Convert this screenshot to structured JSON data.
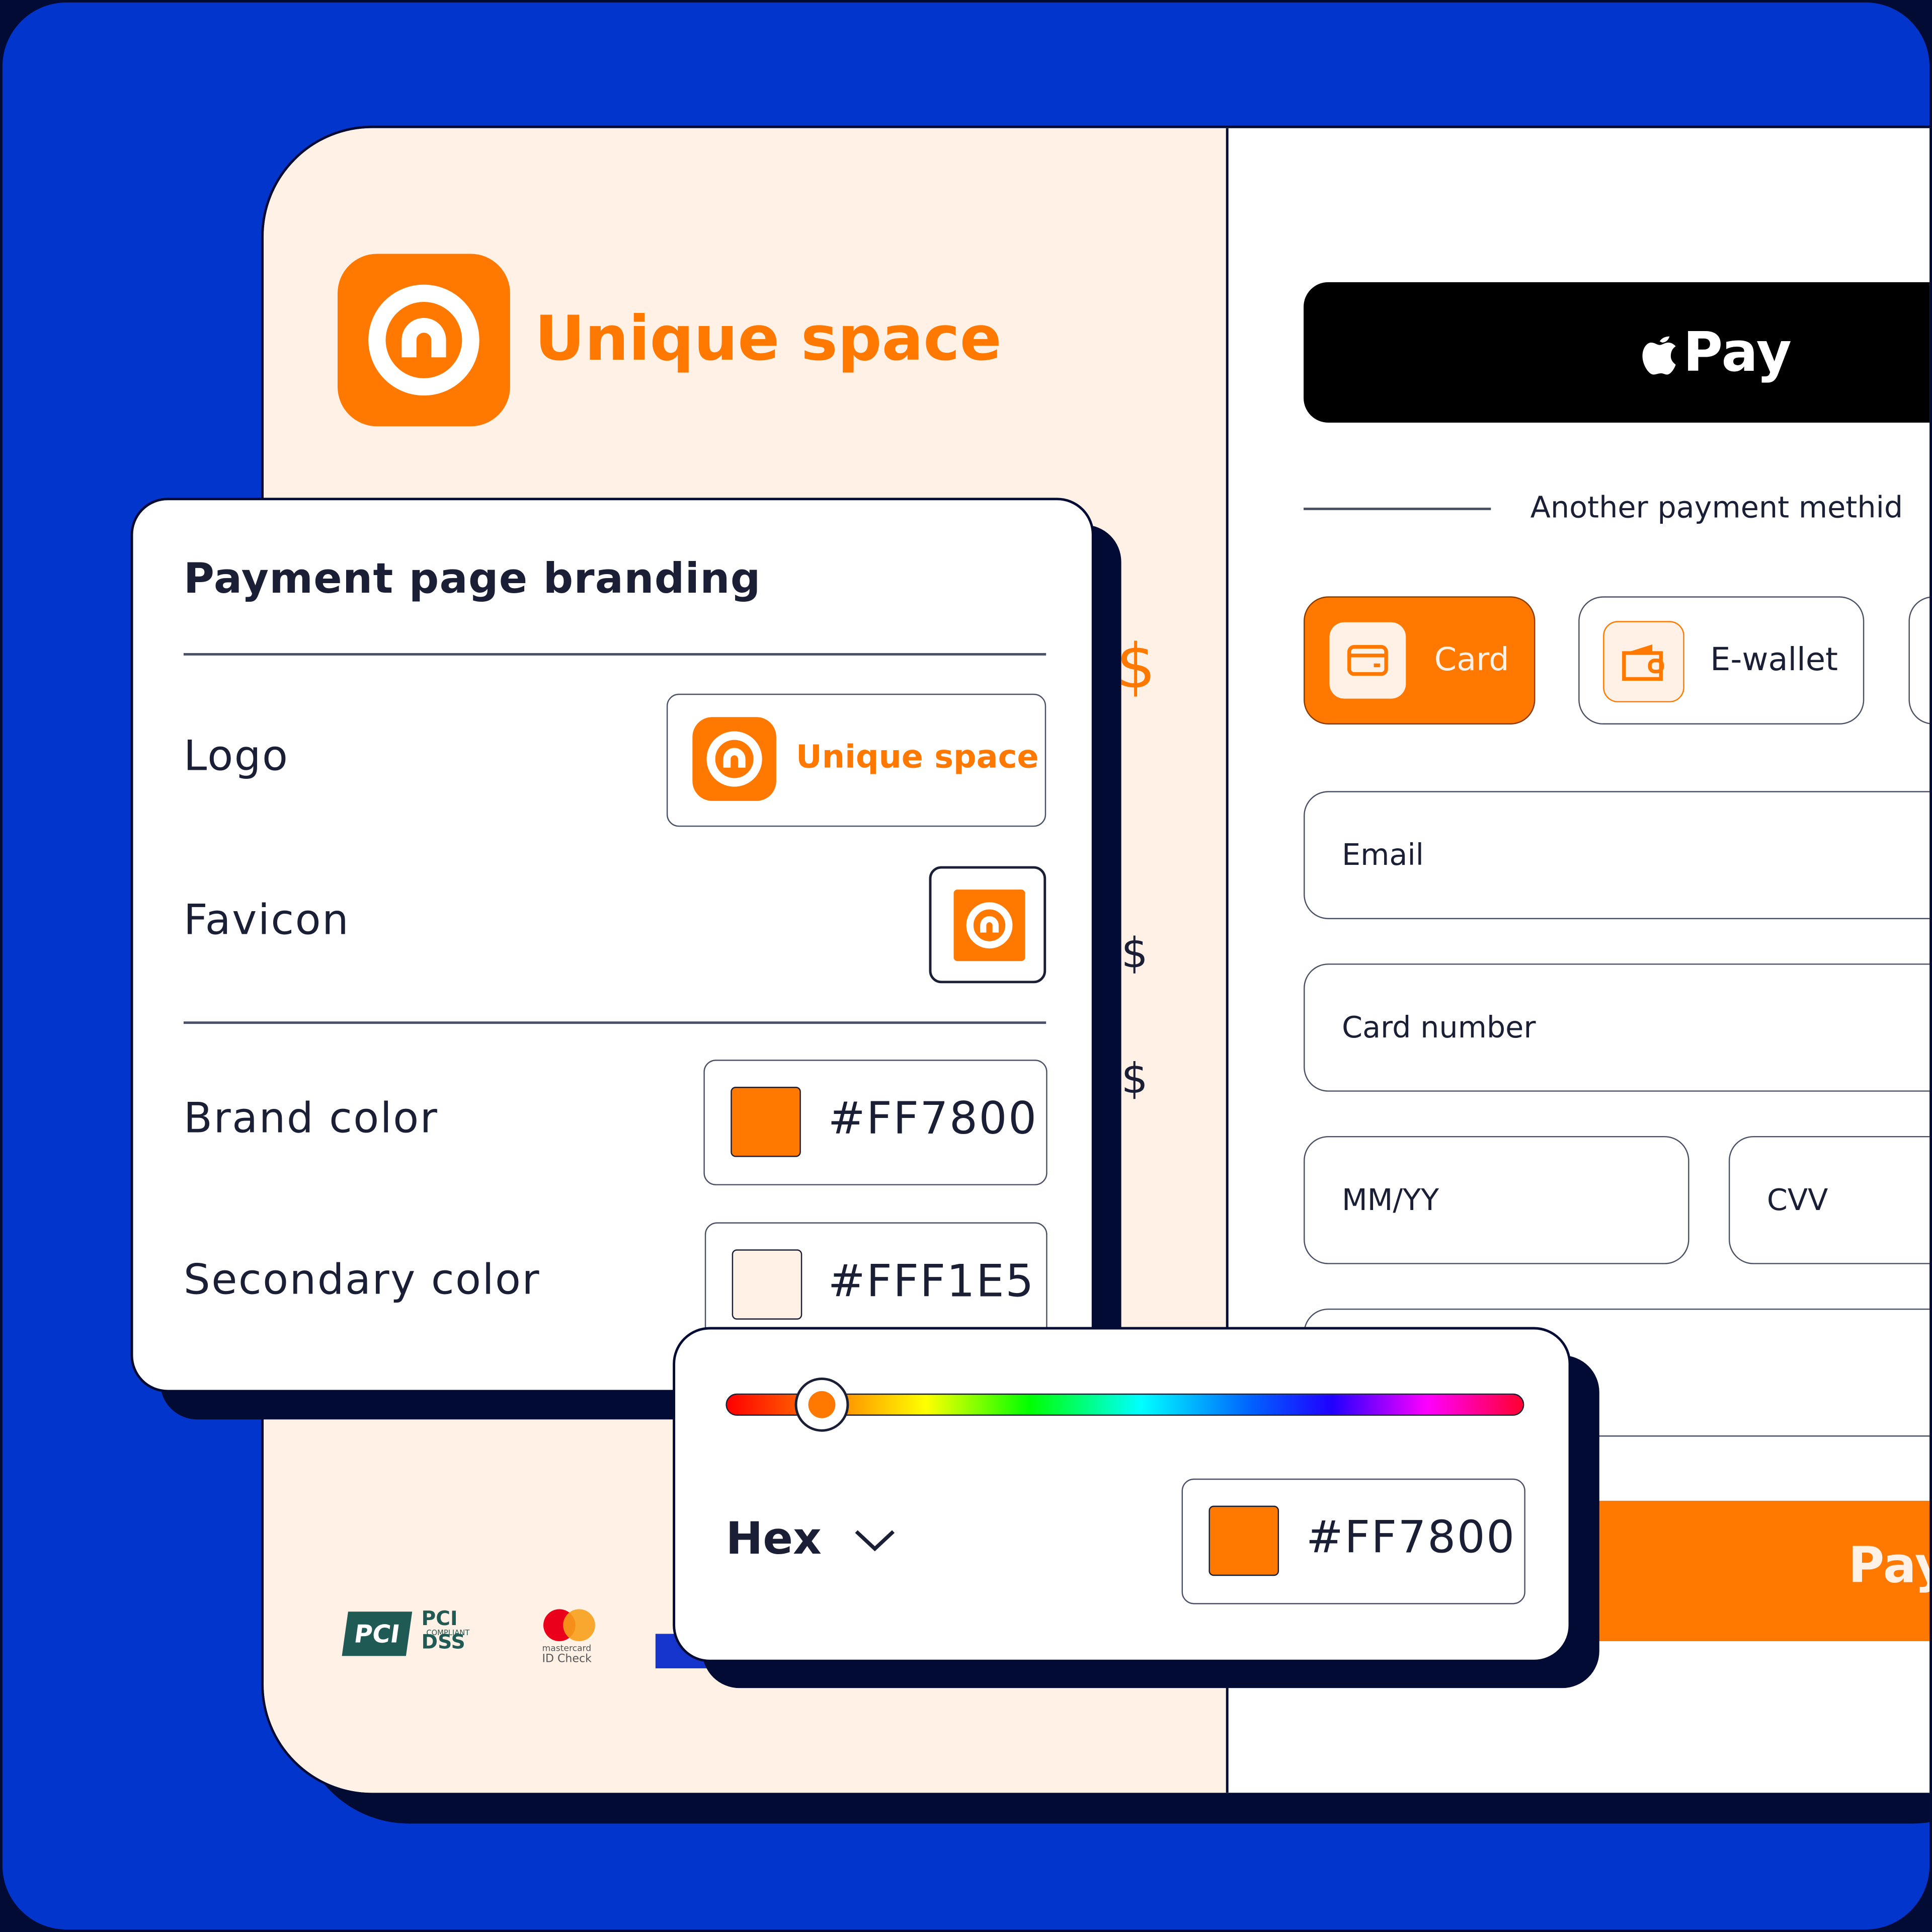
{
  "brand": {
    "name": "Unique space",
    "color": "#FF7800",
    "secondary": "#FFF1E5",
    "background": "#0235CC"
  },
  "checkout": {
    "apple_pay_label": "Pay",
    "divider_text": "Another payment methid",
    "methods": [
      {
        "label": "Card",
        "icon": "credit-card-icon",
        "selected": true
      },
      {
        "label": "E-wallet",
        "icon": "wallet-icon",
        "selected": false
      }
    ],
    "fields": {
      "email": "Email",
      "card_number": "Card number",
      "expiry": "MM/YY",
      "cvv": "CVV"
    },
    "pay_label": "Pay",
    "currency_symbols": [
      "$",
      "$",
      "$"
    ]
  },
  "badges": {
    "pci": "PCI DSS",
    "pci_sub": "COMPLIANT",
    "mastercard": "mastercard",
    "mastercard_sub": "ID Check"
  },
  "branding": {
    "title": "Payment page branding",
    "logo_label": "Logo",
    "favicon_label": "Favicon",
    "brand_color_label": "Brand color",
    "brand_color_value": "#FF7800",
    "secondary_color_label": "Secondary color",
    "secondary_color_value": "#FFF1E5"
  },
  "picker": {
    "format": "Hex",
    "value": "#FF7800",
    "hue_percent": 12
  }
}
